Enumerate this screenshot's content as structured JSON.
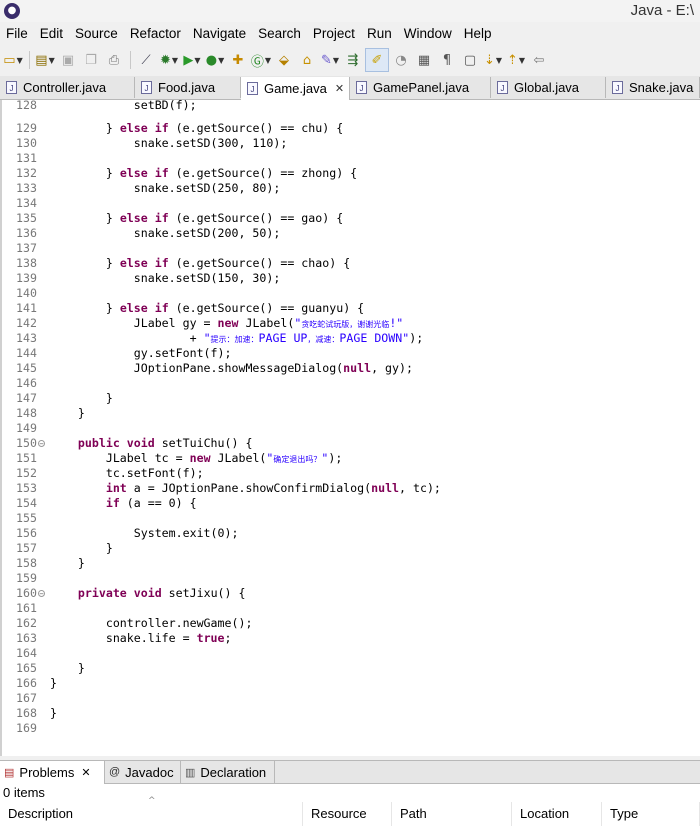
{
  "window": {
    "title": "Java - E:\\",
    "icon": "eclipse-icon"
  },
  "menu": [
    "File",
    "Edit",
    "Source",
    "Refactor",
    "Navigate",
    "Search",
    "Project",
    "Run",
    "Window",
    "Help"
  ],
  "tabs": [
    {
      "label": "Controller.java",
      "active": false
    },
    {
      "label": "Food.java",
      "active": false
    },
    {
      "label": "Game.java",
      "active": true
    },
    {
      "label": "GamePanel.java",
      "active": false
    },
    {
      "label": "Global.java",
      "active": false
    },
    {
      "label": "Snake.java",
      "active": false
    }
  ],
  "editor": {
    "lines": [
      {
        "n": "128",
        "t": "            setBD(f);"
      },
      {
        "n": "129",
        "t": "        } else if (e.getSource() == chu) {"
      },
      {
        "n": "130",
        "t": "            snake.setSD(300, 110);"
      },
      {
        "n": "131",
        "t": ""
      },
      {
        "n": "132",
        "t": "        } else if (e.getSource() == zhong) {"
      },
      {
        "n": "133",
        "t": "            snake.setSD(250, 80);"
      },
      {
        "n": "134",
        "t": ""
      },
      {
        "n": "135",
        "t": "        } else if (e.getSource() == gao) {"
      },
      {
        "n": "136",
        "t": "            snake.setSD(200, 50);"
      },
      {
        "n": "137",
        "t": ""
      },
      {
        "n": "138",
        "t": "        } else if (e.getSource() == chao) {"
      },
      {
        "n": "139",
        "t": "            snake.setSD(150, 30);"
      },
      {
        "n": "140",
        "t": ""
      },
      {
        "n": "141",
        "t": "        } else if (e.getSource() == guanyu) {"
      },
      {
        "n": "142",
        "t": "            JLabel gy = new JLabel(\"贪吃蛇试玩版，谢谢光临!\""
      },
      {
        "n": "143",
        "t": "                    + \"提示：加速：PAGE UP，减速：PAGE DOWN\");"
      },
      {
        "n": "144",
        "t": "            gy.setFont(f);"
      },
      {
        "n": "145",
        "t": "            JOptionPane.showMessageDialog(null, gy);"
      },
      {
        "n": "146",
        "t": ""
      },
      {
        "n": "147",
        "t": "        }"
      },
      {
        "n": "148",
        "t": "    }"
      },
      {
        "n": "149",
        "t": ""
      },
      {
        "n": "150",
        "t": "    public void setTuiChu() {",
        "fold": true
      },
      {
        "n": "151",
        "t": "        JLabel tc = new JLabel(\"确定退出吗？\");"
      },
      {
        "n": "152",
        "t": "        tc.setFont(f);"
      },
      {
        "n": "153",
        "t": "        int a = JOptionPane.showConfirmDialog(null, tc);"
      },
      {
        "n": "154",
        "t": "        if (a == 0) {"
      },
      {
        "n": "155",
        "t": ""
      },
      {
        "n": "156",
        "t": "            System.exit(0);"
      },
      {
        "n": "157",
        "t": "        }"
      },
      {
        "n": "158",
        "t": "    }"
      },
      {
        "n": "159",
        "t": ""
      },
      {
        "n": "160",
        "t": "    private void setJixu() {",
        "fold": true
      },
      {
        "n": "161",
        "t": ""
      },
      {
        "n": "162",
        "t": "        controller.newGame();"
      },
      {
        "n": "163",
        "t": "        snake.life = true;"
      },
      {
        "n": "164",
        "t": ""
      },
      {
        "n": "165",
        "t": "    }"
      },
      {
        "n": "166",
        "t": "}"
      },
      {
        "n": "167",
        "t": ""
      },
      {
        "n": "168",
        "t": "}"
      },
      {
        "n": "169",
        "t": ""
      }
    ]
  },
  "bottom_panel": {
    "tabs": [
      {
        "label": "Problems",
        "icon": "problems-icon",
        "active": true
      },
      {
        "label": "Javadoc",
        "icon": "at-icon",
        "active": false
      },
      {
        "label": "Declaration",
        "icon": "declaration-icon",
        "active": false
      }
    ],
    "items_count": "0 items",
    "columns": [
      "Description",
      "Resource",
      "Path",
      "Location",
      "Type"
    ]
  }
}
